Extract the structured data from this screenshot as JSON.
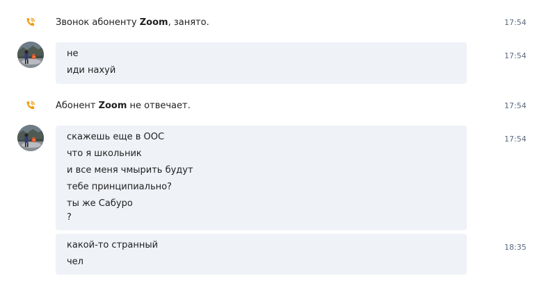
{
  "colors": {
    "call_icon": "#f39c12",
    "bubble_bg": "#eff2f7",
    "timestamp": "#5a6b7f"
  },
  "events": {
    "call1": {
      "icon": "phone-call-icon",
      "prefix": "Звонок абоненту ",
      "name": "Zoom",
      "suffix": ", занято.",
      "time": "17:54"
    },
    "call2": {
      "icon": "phone-call-icon",
      "prefix": "Абонент ",
      "name": "Zoom",
      "suffix": " не отвечает.",
      "time": "17:54"
    }
  },
  "messages": {
    "m1": {
      "time": "17:54",
      "lines": [
        "не",
        "иди нахуй"
      ]
    },
    "m2": {
      "time": "17:54",
      "lines": [
        "скажешь еще в ООС",
        "что я школьник",
        "и все меня чмырить будут",
        "тебе принципиально?",
        "ты же Сабуро",
        "?"
      ]
    },
    "m3": {
      "time": "18:35",
      "lines": [
        "какой-то странный",
        "чел"
      ]
    }
  }
}
